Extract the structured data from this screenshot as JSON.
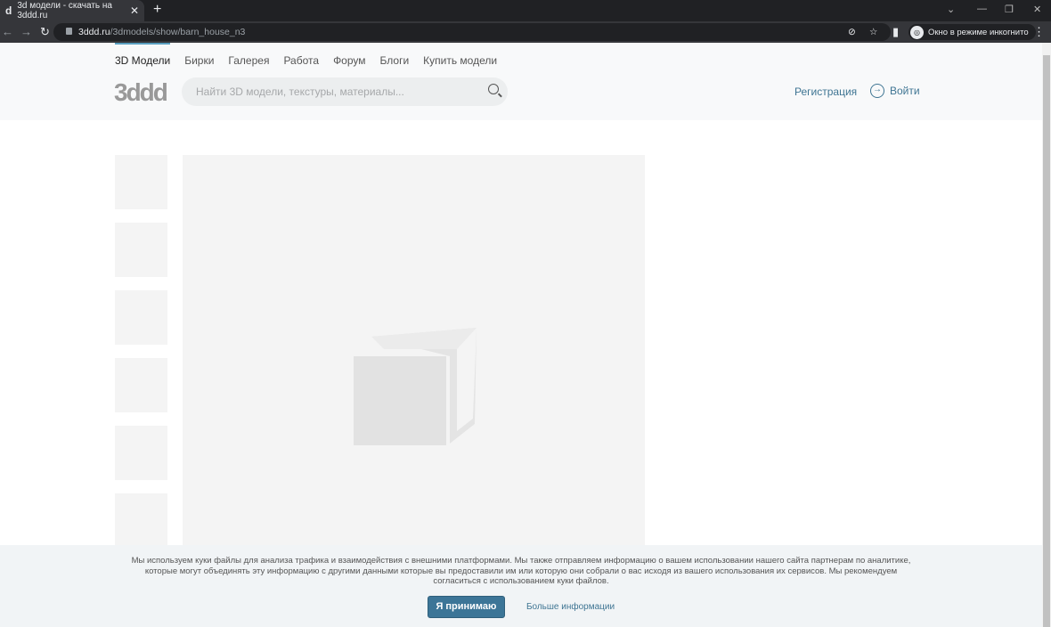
{
  "browser": {
    "tab_title": "3d модели - скачать на 3ddd.ru",
    "favicon": "d",
    "url_host": "3ddd.ru",
    "url_path": "/3dmodels/show/barn_house_n3",
    "incognito_label": "Окно в режиме инкогнито"
  },
  "nav": {
    "items": [
      "3D Модели",
      "Бирки",
      "Галерея",
      "Работа",
      "Форум",
      "Блоги",
      "Купить модели"
    ]
  },
  "logo": "3ddd",
  "search": {
    "placeholder": "Найти 3D модели, текстуры, материалы..."
  },
  "auth": {
    "register": "Регистрация",
    "login": "Войти"
  },
  "cookie": {
    "text": "Мы используем куки файлы для анализа трафика и взаимодействия с внешними платформами. Мы также отправляем информацию о вашем использовании нашего сайта партнерам по аналитике, которые могут объединять эту информацию с другими данными которые вы предоставили им или которую они собрали о вас исходя из вашего использования их сервисов. Мы рекомендуем согласиться с использованием куки файлов.",
    "accept": "Я принимаю",
    "more": "Больше информации"
  },
  "colors": {
    "accent": "#3f7593",
    "button": "#3c7597"
  }
}
